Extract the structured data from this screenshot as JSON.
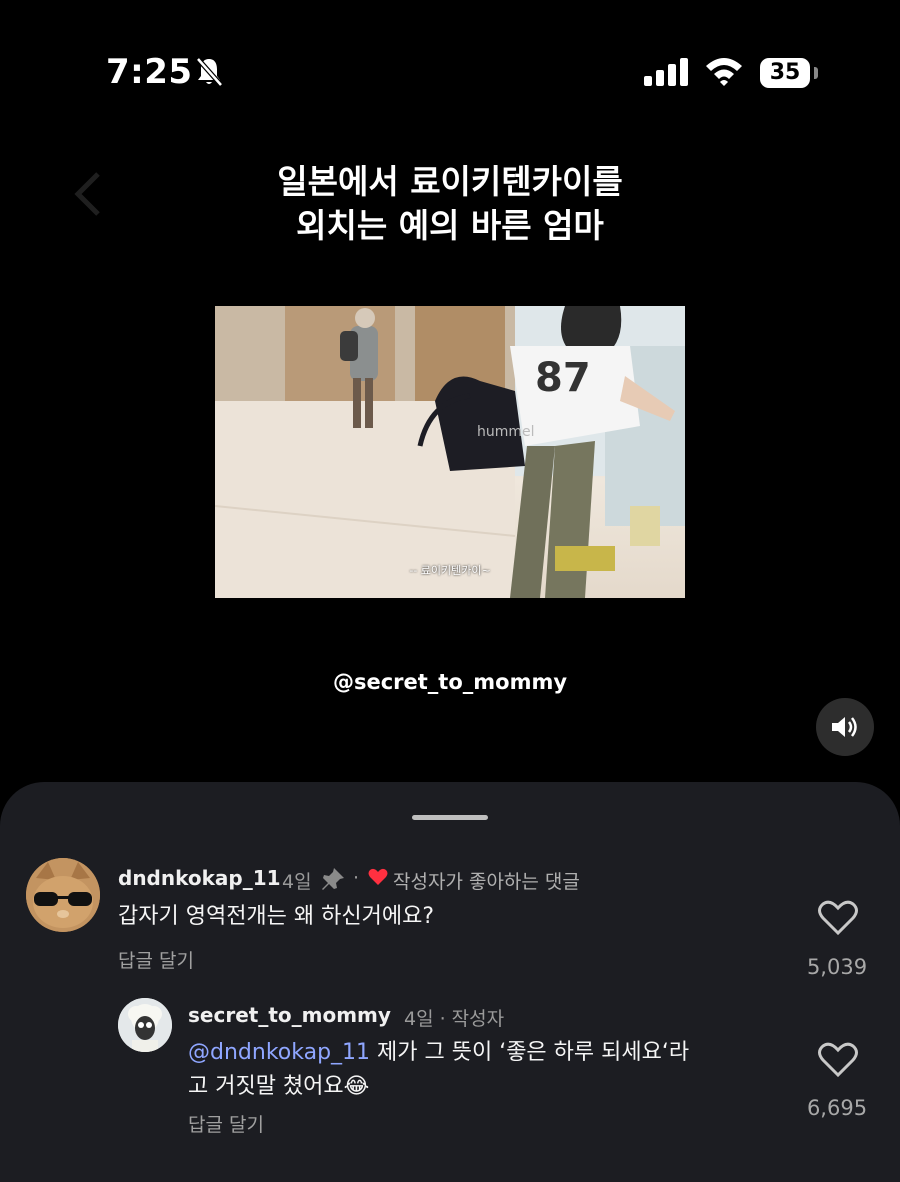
{
  "status": {
    "time": "7:25",
    "battery": "35"
  },
  "icons": {
    "bell": "bell-slash-icon",
    "signal": "cellular-signal-icon",
    "wifi": "wifi-icon",
    "sound": "speaker-icon",
    "like": "heart-outline-icon",
    "pin": "pin-icon",
    "author_like": "heart-filled-icon"
  },
  "video": {
    "title_line1": "일본에서 료이키텐카이를",
    "title_line2": "외치는 예의 바른 엄마",
    "frame_subtitle": "-- 료이키텐카이~",
    "handle": "@secret_to_mommy"
  },
  "comments": [
    {
      "username": "dndnkokap_11",
      "age": "4일",
      "dot": "·",
      "author_liked": "작성자가 좋아하는 댓글",
      "text": "갑자기 영역전개는 왜 하신거에요?",
      "reply_label": "답글 달기",
      "likes": "5,039"
    },
    {
      "username": "secret_to_mommy",
      "meta": "4일 · 작성자",
      "mention": "@dndnkokap_11",
      "text_line1": " 제가 그 뜻이 ‘좋은 하루 되세요‘라",
      "text_line2": "고 거짓말 쳤어요",
      "emoji": "😂",
      "reply_label": "답글 달기",
      "likes": "6,695"
    }
  ],
  "colors": {
    "background": "#000000",
    "sheet": "#1c1d22",
    "mention": "#8fa6ff",
    "heart_red": "#ff3040"
  }
}
